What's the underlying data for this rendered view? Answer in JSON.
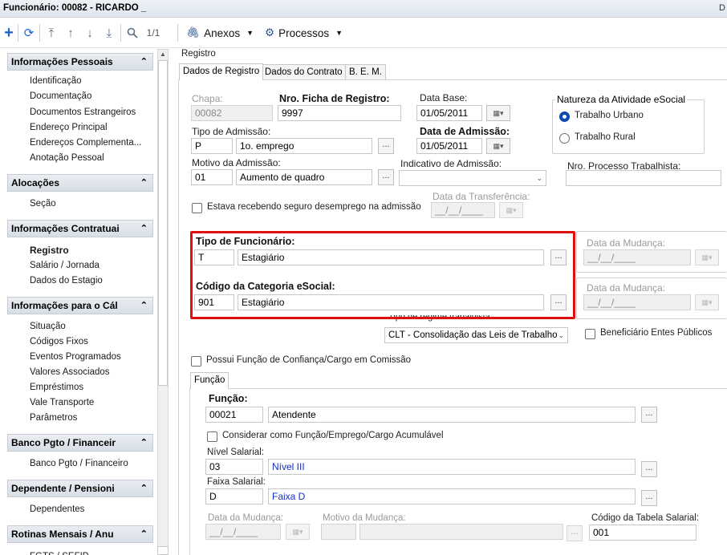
{
  "window": {
    "title": "Funcionário: 00082 - RICARDO _",
    "right_label": "D"
  },
  "toolbar": {
    "page_indicator": "1/1",
    "anexos": "Anexos",
    "processos": "Processos"
  },
  "sidebar": {
    "groups": [
      {
        "label": "Informações Pessoais",
        "items": [
          "Identificação",
          "Documentação",
          "Documentos Estrangeiros",
          "Endereço Principal",
          "Endereços Complementa...",
          "Anotação Pessoal"
        ]
      },
      {
        "label": "Alocações",
        "items": [
          "Seção"
        ]
      },
      {
        "label": "Informações Contratuai",
        "items": [
          "Registro",
          "Salário / Jornada",
          "Dados do Estagio"
        ]
      },
      {
        "label": "Informações para o Cál",
        "items": [
          "Situação",
          "Códigos Fixos",
          "Eventos Programados",
          "Valores Associados",
          "Empréstimos",
          "Vale Transporte",
          "Parâmetros"
        ]
      },
      {
        "label": "Banco Pgto / Financeir",
        "items": [
          "Banco Pgto / Financeiro"
        ]
      },
      {
        "label": "Dependente / Pensioni",
        "items": [
          "Dependentes"
        ]
      },
      {
        "label": "Rotinas Mensais / Anu",
        "items": [
          "FGTS / SEFIP"
        ]
      }
    ]
  },
  "registro": {
    "section_label": "Registro",
    "tabs": [
      "Dados de Registro",
      "Dados do Contrato",
      "B. E. M."
    ],
    "chapa_label": "Chapa:",
    "chapa_value": "00082",
    "ficha_label": "Nro. Ficha de Registro:",
    "ficha_value": "9997",
    "data_base_label": "Data Base:",
    "data_base_value": "01/05/2011",
    "natureza_label": "Natureza da Atividade eSocial",
    "natureza_opt1": "Trabalho Urbano",
    "natureza_opt2": "Trabalho Rural",
    "tipo_admissao_label": "Tipo de Admissão:",
    "tipo_admissao_code": "P",
    "tipo_admissao_desc": "1o. emprego",
    "data_admissao_label": "Data de Admissão:",
    "data_admissao_value": "01/05/2011",
    "motivo_label": "Motivo da Admissão:",
    "motivo_code": "01",
    "motivo_desc": "Aumento de quadro",
    "indicativo_label": "Indicativo de Admissão:",
    "nro_processo_label": "Nro. Processo Trabalhista:",
    "seguro_label": "Estava recebendo seguro desemprego na admissão",
    "data_transf_label": "Data da Transferência:",
    "date_placeholder": "__/__/____",
    "tipo_func_label": "Tipo de Funcionário:",
    "tipo_func_code": "T",
    "tipo_func_desc": "Estagiário",
    "data_mudanca_label": "Data da Mudança:",
    "categoria_label": "Código da Categoria eSocial:",
    "categoria_code": "901",
    "categoria_desc": "Estagiário",
    "regime_label": "Tipo de regime trabalhista:",
    "regime_value": "CLT - Consolidação das Leis de Trabalho",
    "beneficiario_label": "Beneficiário Entes Públicos",
    "funcao_confianca_label": "Possui Função de Confiança/Cargo em Comissão",
    "funcao_tab": "Função",
    "funcao_label": "Função:",
    "funcao_code": "00021",
    "funcao_desc": "Atendente",
    "acumulavel_label": "Considerar como Função/Emprego/Cargo Acumulável",
    "nivel_label": "Nível Salarial:",
    "nivel_code": "03",
    "nivel_desc": "Nível III",
    "faixa_label": "Faixa Salarial:",
    "faixa_code": "D",
    "faixa_desc": "Faixa D",
    "motivo_mudanca_label": "Motivo da Mudança:",
    "codigo_tabela_label": "Código da Tabela Salarial:",
    "codigo_tabela_value": "001",
    "ellipsis": "..."
  }
}
